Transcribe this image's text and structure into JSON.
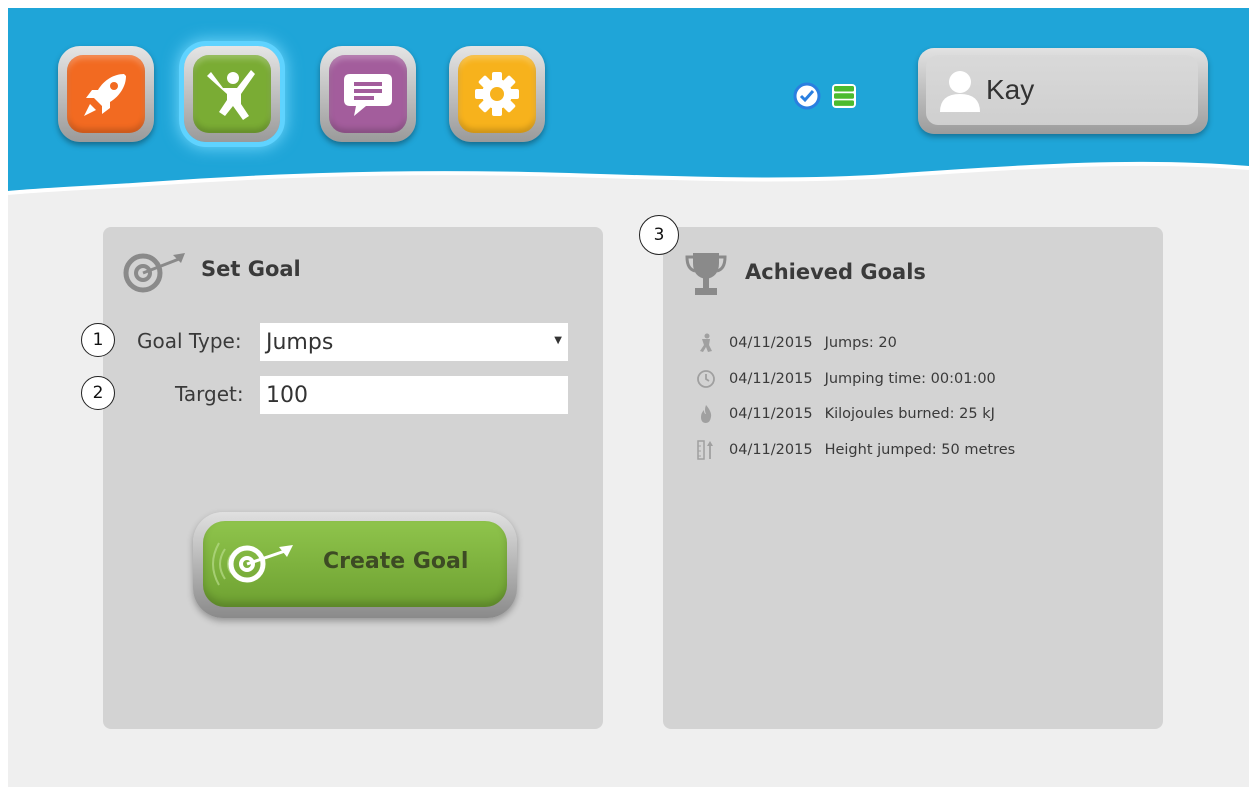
{
  "header": {
    "app_buttons": [
      {
        "icon": "rocket-icon",
        "color": "#f26a21"
      },
      {
        "icon": "jumping-person-icon",
        "color": "#7aac34",
        "active": true
      },
      {
        "icon": "chat-bubble-icon",
        "color": "#a35d9c"
      },
      {
        "icon": "gear-icon",
        "color": "#f7b21c"
      }
    ],
    "status_icons": [
      "check-circle-icon",
      "list-icon"
    ],
    "user": {
      "name": "Kay",
      "icon": "user-silhouette-icon"
    },
    "colors": {
      "header_blue": "#1fa5d8"
    }
  },
  "set_goal": {
    "title": "Set Goal",
    "goal_type": {
      "marker": "1",
      "label": "Goal Type:",
      "value": "Jumps"
    },
    "target": {
      "marker": "2",
      "label": "Target:",
      "value": "100"
    },
    "create_button_label": "Create Goal"
  },
  "achieved_goals": {
    "marker": "3",
    "title": "Achieved Goals",
    "items": [
      {
        "icon": "jump-icon",
        "date": "04/11/2015",
        "text": "Jumps: 20"
      },
      {
        "icon": "clock-icon",
        "date": "04/11/2015",
        "text": "Jumping time: 00:01:00"
      },
      {
        "icon": "flame-icon",
        "date": "04/11/2015",
        "text": "Kilojoules burned: 25 kJ"
      },
      {
        "icon": "height-icon",
        "date": "04/11/2015",
        "text": "Height jumped: 50 metres"
      }
    ]
  }
}
